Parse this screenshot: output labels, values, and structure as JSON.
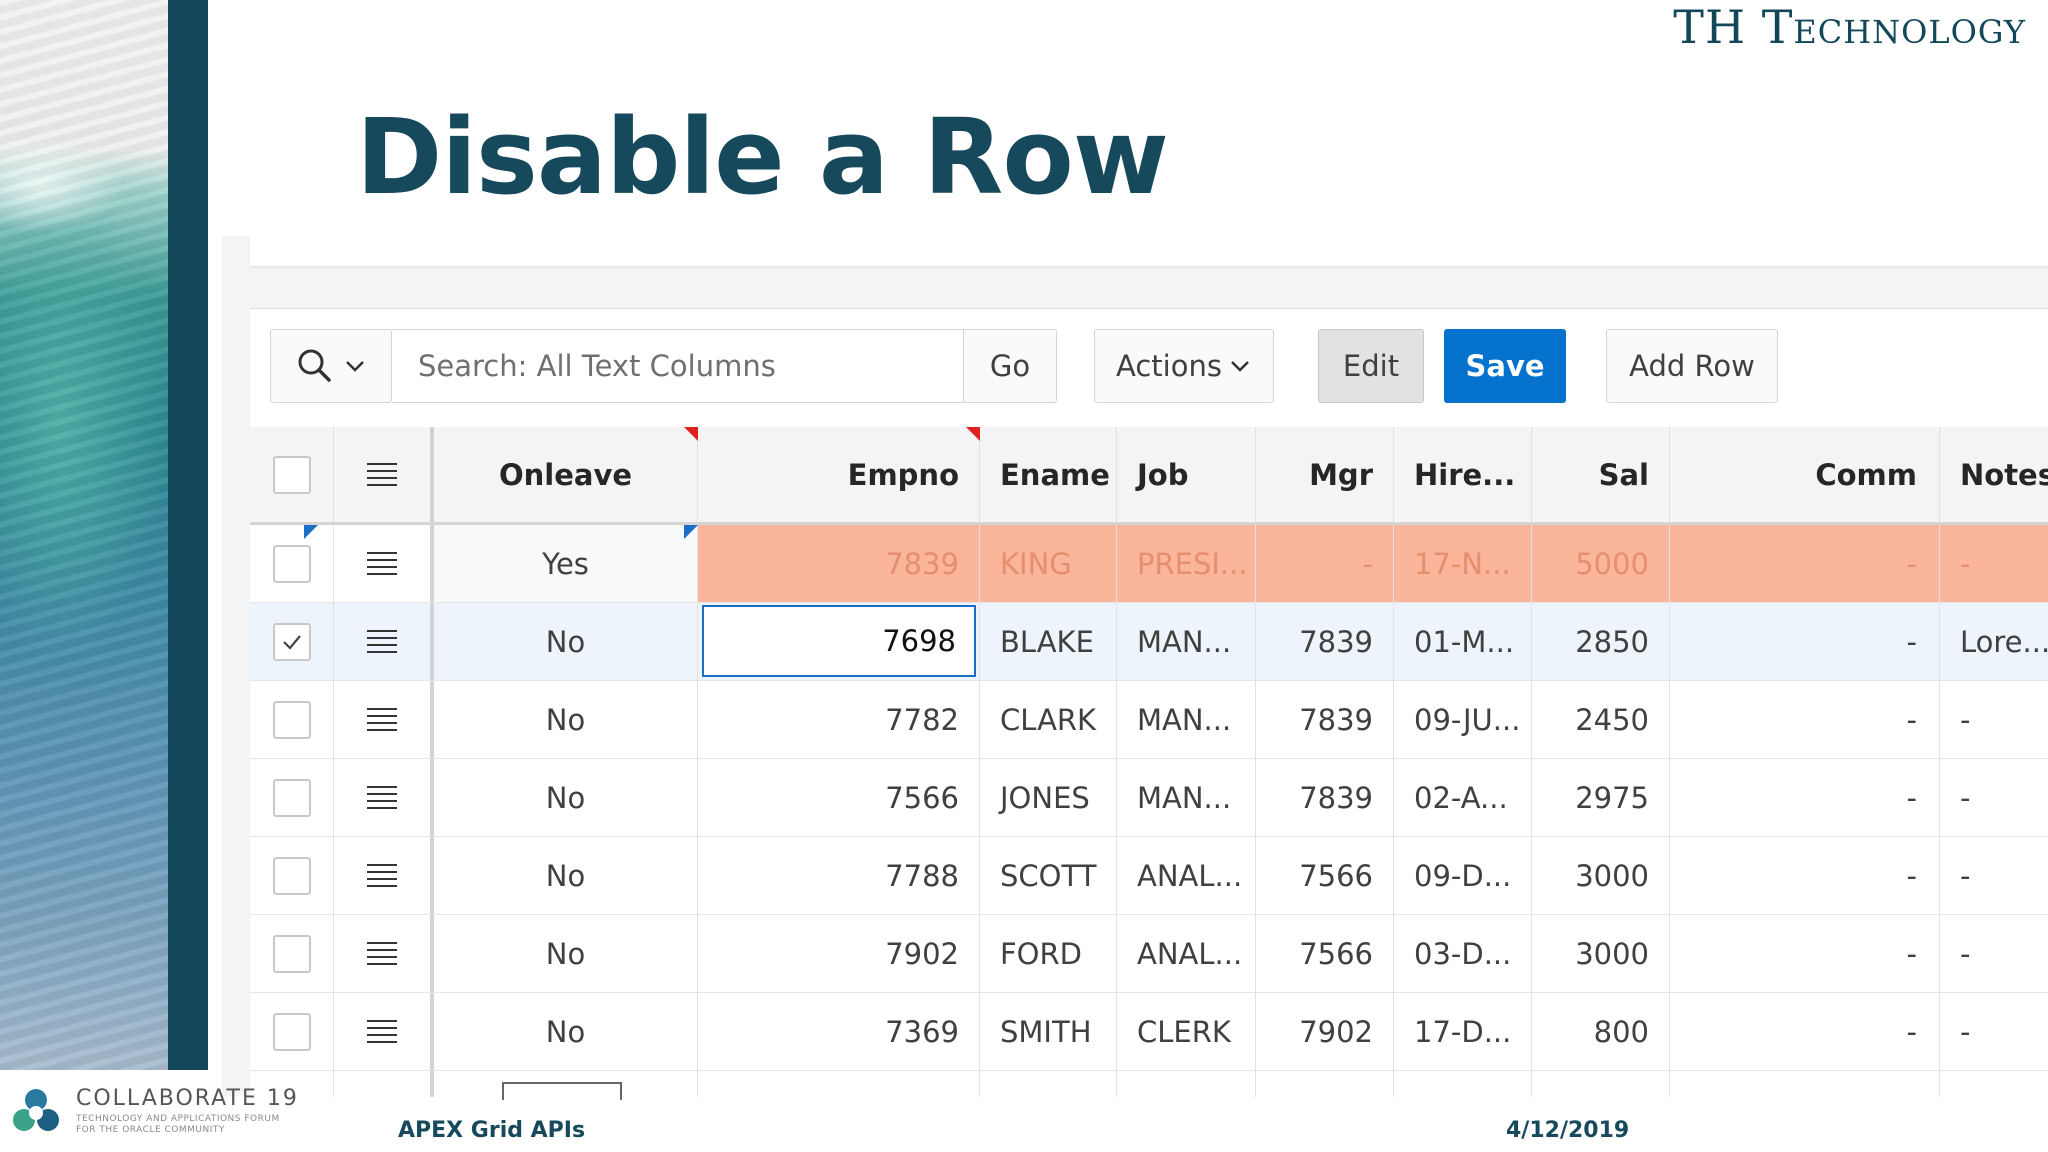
{
  "slide": {
    "brand": "TH Technology",
    "title": "Disable a Row",
    "footer_left": "APEX Grid APIs",
    "footer_right": "4/12/2019",
    "footer_brand": "COLLABORATE 19",
    "footer_brand_tagline_1": "TECHNOLOGY AND APPLICATIONS FORUM",
    "footer_brand_tagline_2": "FOR THE ORACLE COMMUNITY"
  },
  "toolbar": {
    "search_placeholder": "Search: All Text Columns",
    "go_label": "Go",
    "actions_label": "Actions",
    "edit_label": "Edit",
    "save_label": "Save",
    "add_row_label": "Add Row"
  },
  "columns": {
    "onleave": "Onleave",
    "empno": "Empno",
    "ename": "Ename",
    "job": "Job",
    "mgr": "Mgr",
    "hire": "Hire...",
    "sal": "Sal",
    "comm": "Comm",
    "notes": "Notes"
  },
  "rows": [
    {
      "onleave": "Yes",
      "empno": "7839",
      "ename": "KING",
      "job": "PRESI...",
      "mgr": "-",
      "hire": "17-N...",
      "sal": "5000",
      "comm": "-",
      "notes": "-",
      "checked": false,
      "state": "disabled"
    },
    {
      "onleave": "No",
      "empno": "7698",
      "ename": "BLAKE",
      "job": "MAN...",
      "mgr": "7839",
      "hire": "01-M...",
      "sal": "2850",
      "comm": "-",
      "notes": "Lore...",
      "checked": true,
      "state": "selected"
    },
    {
      "onleave": "No",
      "empno": "7782",
      "ename": "CLARK",
      "job": "MAN...",
      "mgr": "7839",
      "hire": "09-JU...",
      "sal": "2450",
      "comm": "-",
      "notes": "-",
      "checked": false,
      "state": "normal"
    },
    {
      "onleave": "No",
      "empno": "7566",
      "ename": "JONES",
      "job": "MAN...",
      "mgr": "7839",
      "hire": "02-A...",
      "sal": "2975",
      "comm": "-",
      "notes": "-",
      "checked": false,
      "state": "normal"
    },
    {
      "onleave": "No",
      "empno": "7788",
      "ename": "SCOTT",
      "job": "ANAL...",
      "mgr": "7566",
      "hire": "09-D...",
      "sal": "3000",
      "comm": "-",
      "notes": "-",
      "checked": false,
      "state": "normal"
    },
    {
      "onleave": "No",
      "empno": "7902",
      "ename": "FORD",
      "job": "ANAL...",
      "mgr": "7566",
      "hire": "03-D...",
      "sal": "3000",
      "comm": "-",
      "notes": "-",
      "checked": false,
      "state": "normal"
    },
    {
      "onleave": "No",
      "empno": "7369",
      "ename": "SMITH",
      "job": "CLERK",
      "mgr": "7902",
      "hire": "17-D...",
      "sal": "800",
      "comm": "-",
      "notes": "-",
      "checked": false,
      "state": "normal"
    }
  ],
  "colors": {
    "disabled_row": "#fbb59a",
    "selected_row": "#eef4fb",
    "primary_button": "#0572ce",
    "title": "#17495c"
  }
}
